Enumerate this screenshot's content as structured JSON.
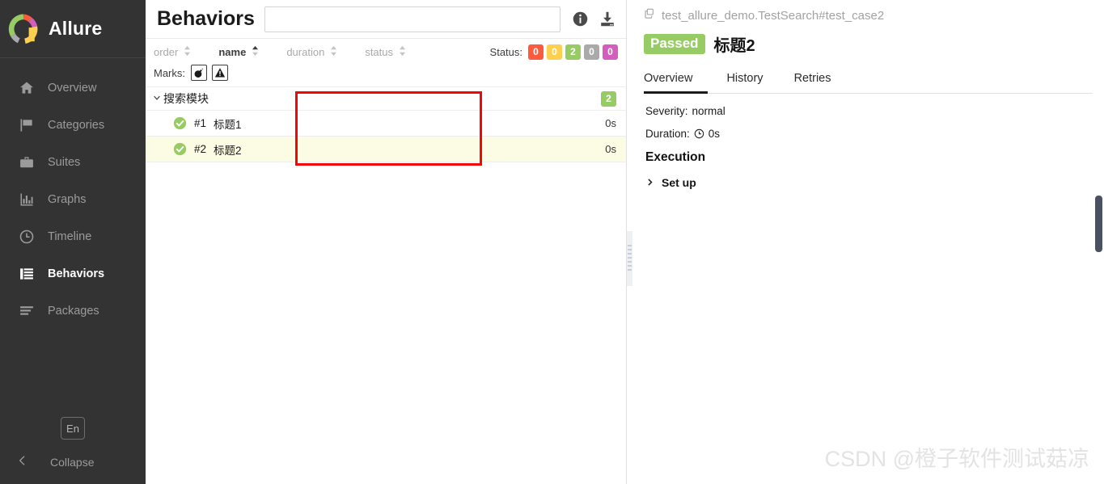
{
  "sidebar": {
    "brand": "Allure",
    "items": [
      {
        "label": "Overview",
        "icon": "home-icon",
        "active": false
      },
      {
        "label": "Categories",
        "icon": "flag-icon",
        "active": false
      },
      {
        "label": "Suites",
        "icon": "briefcase-icon",
        "active": false
      },
      {
        "label": "Graphs",
        "icon": "bar-chart-icon",
        "active": false
      },
      {
        "label": "Timeline",
        "icon": "clock-icon",
        "active": false
      },
      {
        "label": "Behaviors",
        "icon": "list-icon",
        "active": true
      },
      {
        "label": "Packages",
        "icon": "layers-icon",
        "active": false
      }
    ],
    "language_chip": "En",
    "collapse_label": "Collapse",
    "active_indicator_color": "#5ba8f5",
    "background_color": "#333333"
  },
  "center": {
    "title": "Behaviors",
    "search": {
      "value": "",
      "placeholder": ""
    },
    "header_icons": [
      {
        "name": "info-icon"
      },
      {
        "name": "download-icon"
      }
    ],
    "sorters": [
      {
        "label": "order",
        "active": false
      },
      {
        "label": "name",
        "active": true
      },
      {
        "label": "duration",
        "active": false
      },
      {
        "label": "status",
        "active": false
      }
    ],
    "status_filter": {
      "label": "Status:",
      "chips": [
        {
          "value": "0",
          "color": "#fd5a3e",
          "name": "failed"
        },
        {
          "value": "0",
          "color": "#ffd050",
          "name": "broken"
        },
        {
          "value": "2",
          "color": "#97cc64",
          "name": "passed"
        },
        {
          "value": "0",
          "color": "#aaaaaa",
          "name": "skipped"
        },
        {
          "value": "0",
          "color": "#d35ebe",
          "name": "unknown"
        }
      ]
    },
    "marks": {
      "label": "Marks:",
      "buttons": [
        {
          "name": "flaky-bomb-icon"
        },
        {
          "name": "warning-triangle-icon"
        }
      ]
    },
    "tree": {
      "group": {
        "name": "搜索模块",
        "expanded": true,
        "count_badge": "2",
        "badge_color": "#97cc64"
      },
      "leaves": [
        {
          "order": "#1",
          "name": "标题1",
          "duration": "0s",
          "status": "passed",
          "selected": false
        },
        {
          "order": "#2",
          "name": "标题2",
          "duration": "0s",
          "status": "passed",
          "selected": true
        }
      ]
    },
    "annotation_box_color": "#f50606"
  },
  "right": {
    "path": "test_allure_demo.TestSearch#test_case2",
    "path_icon": "copy-icon",
    "status_label": "Passed",
    "status_color": "#97cc64",
    "title": "标题2",
    "tabs": [
      {
        "label": "Overview",
        "active": true
      },
      {
        "label": "History",
        "active": false
      },
      {
        "label": "Retries",
        "active": false
      }
    ],
    "severity": {
      "label": "Severity:",
      "value": "normal"
    },
    "duration": {
      "label": "Duration:",
      "value": "0s",
      "icon": "clock-icon"
    },
    "execution_heading": "Execution",
    "steps": [
      {
        "label": "Set up",
        "expanded": false
      }
    ]
  },
  "watermark": "CSDN @橙子软件测试菇凉"
}
